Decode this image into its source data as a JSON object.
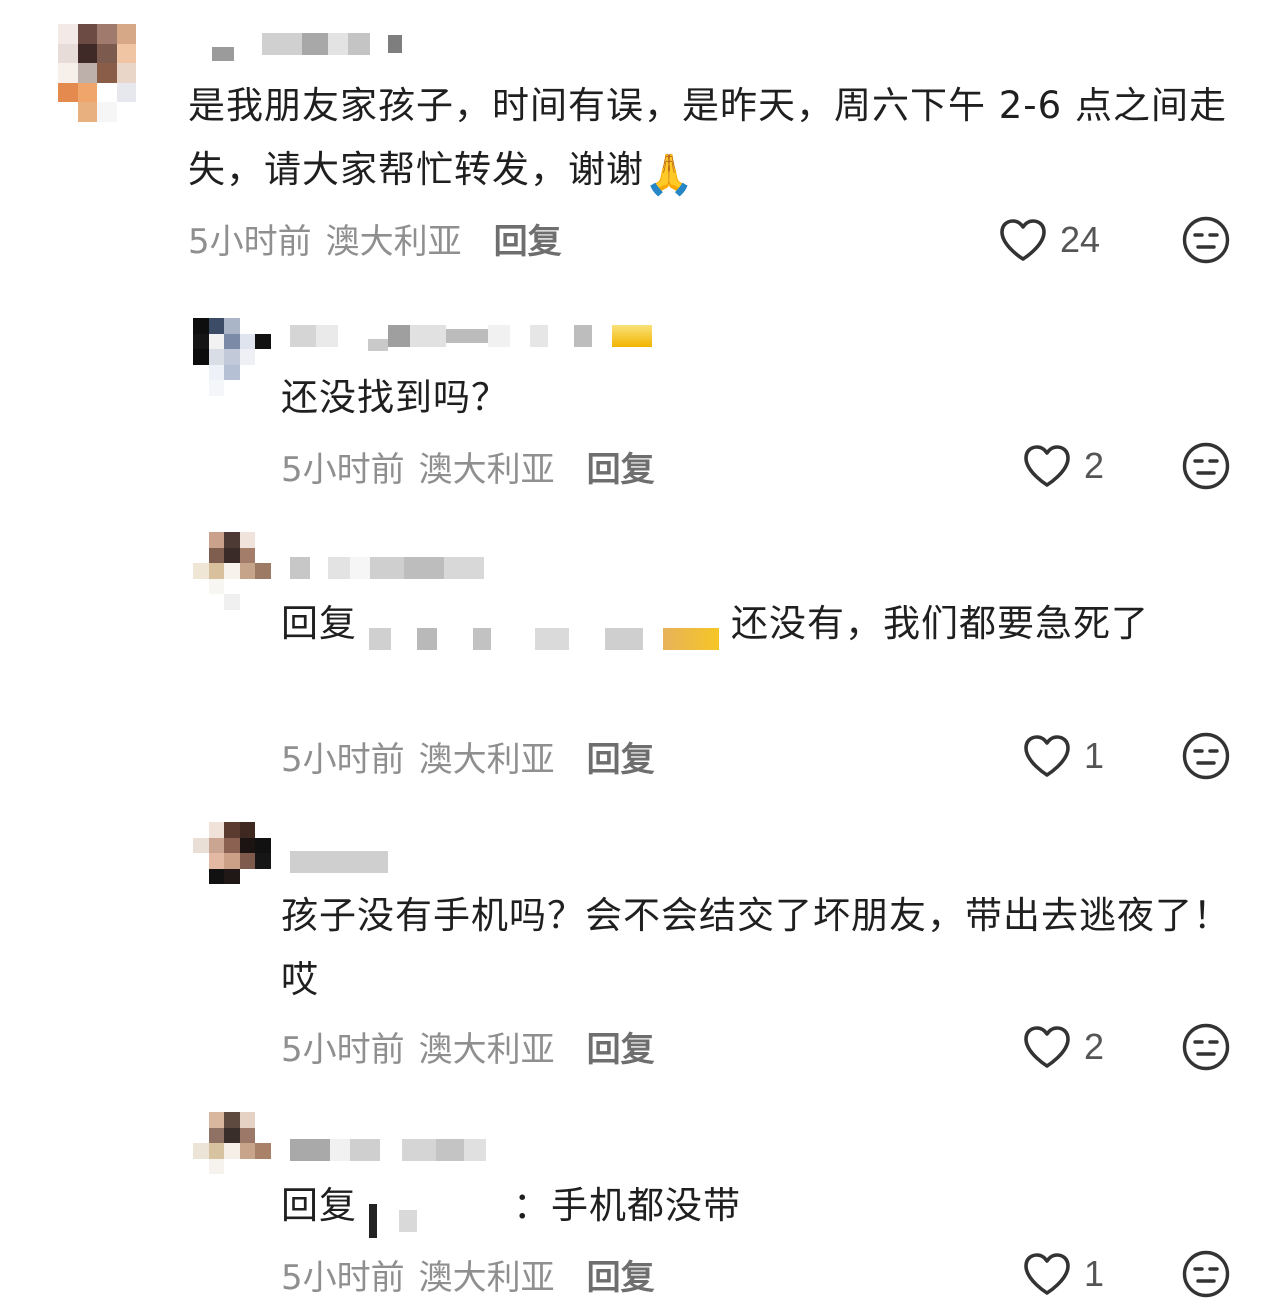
{
  "comments": [
    {
      "text": "是我朋友家孩子，时间有误，是昨天，周六下午 2-6 点之间走失，请大家帮忙转发，谢谢",
      "emoji": "🙏",
      "time": "5小时前",
      "location": "澳大利亚",
      "reply_label": "回复",
      "likes": "24"
    },
    {
      "text": "还没找到吗？",
      "time": "5小时前",
      "location": "澳大利亚",
      "reply_label": "回复",
      "likes": "2"
    },
    {
      "reply_prefix": "回复",
      "text": "还没有，我们都要急死了",
      "time": "5小时前",
      "location": "澳大利亚",
      "reply_label": "回复",
      "likes": "1"
    },
    {
      "text": "孩子没有手机吗？会不会结交了坏朋友，带出去逃夜了！哎",
      "time": "5小时前",
      "location": "澳大利亚",
      "reply_label": "回复",
      "likes": "2"
    },
    {
      "reply_prefix": "回复",
      "text": "：手机都没带",
      "time": "5小时前",
      "location": "澳大利亚",
      "reply_label": "回复",
      "likes": "1"
    }
  ],
  "icons": {
    "like": "heart-outline-icon",
    "dislike": "neutral-face-icon",
    "emoji": "folded-hands-emoji"
  },
  "colors": {
    "text": "#1f1f1f",
    "meta": "#8f8f8f",
    "icon": "#333333"
  }
}
